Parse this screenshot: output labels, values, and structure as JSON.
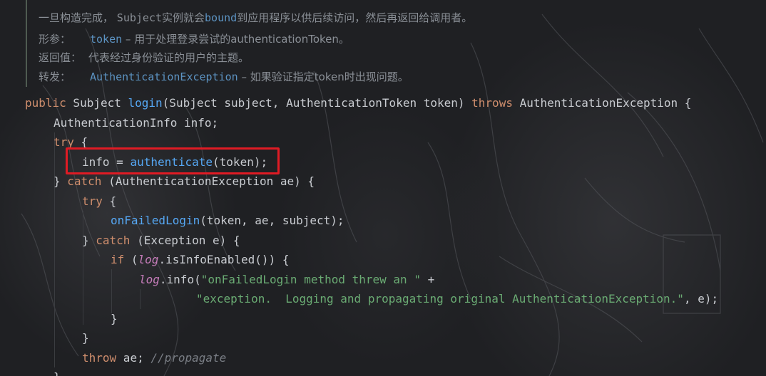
{
  "doc": {
    "summary": "一旦构造完成， Subject实例就会bound到应用程序以供后续访问，然后再返回给调用者。",
    "summary_parts": {
      "a": "一旦构造完成，",
      "b": "Subject",
      "c": "实例就会",
      "d": "bound",
      "e": "到应用程序以供后续访问，然后再返回给调用者。"
    },
    "params_label": "形参：",
    "params_name": "token",
    "params_text": " – 用于处理登录尝试的authenticationToken。",
    "returns_label": "返回值：",
    "returns_text": "代表经过身份验证的用户的主题。",
    "throws_label": "转发：",
    "throws_name": "AuthenticationException",
    "throws_text": " – 如果验证指定token时出现问题。"
  },
  "code": {
    "l1": {
      "kw1": "public",
      "t1": " Subject ",
      "fn": "login",
      "t2": "(Subject subject, AuthenticationToken token) ",
      "kw2": "throws",
      "t3": " AuthenticationException {"
    },
    "l2": {
      "t1": "AuthenticationInfo info;"
    },
    "l3": {
      "kw": "try",
      "t1": " {"
    },
    "l4": {
      "t1": "info = ",
      "fn": "authenticate",
      "t2": "(token);"
    },
    "l5": {
      "t1": "} ",
      "kw": "catch",
      "t2": " (AuthenticationException ae) {"
    },
    "l6": {
      "kw": "try",
      "t1": " {"
    },
    "l7": {
      "fn": "onFailedLogin",
      "t1": "(token, ae, subject);"
    },
    "l8": {
      "t1": "} ",
      "kw": "catch",
      "t2": " (Exception e) {"
    },
    "l9": {
      "kw": "if",
      "t1": " (",
      "fld": "log",
      "t2": ".isInfoEnabled()) {"
    },
    "l10": {
      "fld": "log",
      "t1": ".info(",
      "str": "\"onFailedLogin method threw an \"",
      "t2": " +"
    },
    "l11": {
      "str": "\"exception.  Logging and propagating original AuthenticationException.\"",
      "t1": ", e);"
    },
    "l12": {
      "t1": "}"
    },
    "l13": {
      "t1": "}"
    },
    "l14": {
      "kw": "throw",
      "t1": " ae; ",
      "cmt": "//propagate"
    },
    "l15": {
      "t1": "}"
    }
  },
  "colors": {
    "background": "#1f2023",
    "keyword": "#cf8e6d",
    "function": "#56a8f5",
    "string": "#6aab73",
    "field": "#c77dbb",
    "comment": "#7a7e85",
    "text": "#c9ccd1",
    "doc_text": "#8a8f96",
    "doc_link": "#5c93c2",
    "highlight": "#e01b24"
  }
}
